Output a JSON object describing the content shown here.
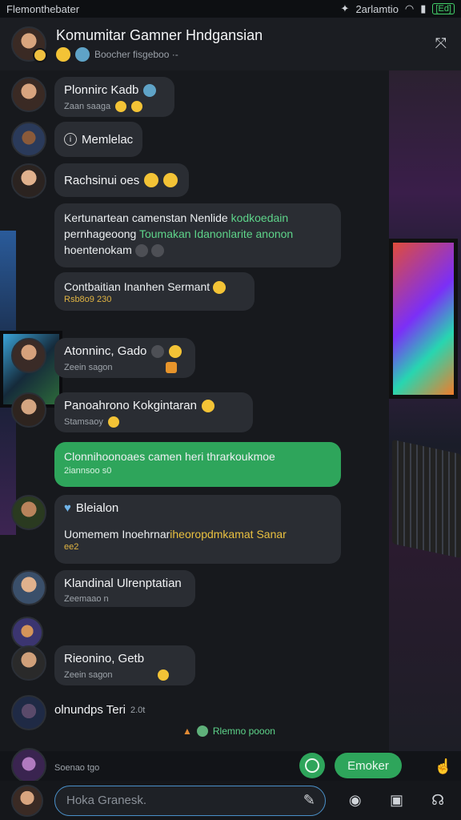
{
  "status_bar": {
    "left_text": "Flemonthebater",
    "time": "2arlamtio",
    "battery": "[Ed]"
  },
  "header": {
    "title": "Komumitar Gamner Hndgansian",
    "subtitle": "Boocher fisgeboo ·-"
  },
  "messages": [
    {
      "id": "m1",
      "name": "Plonnirc Kadb",
      "meta": "Zaan saaga"
    },
    {
      "id": "m2",
      "name": "Memlelac"
    },
    {
      "id": "m3",
      "name": "Rachsinui oes"
    },
    {
      "id": "m4",
      "lines": [
        {
          "parts": [
            {
              "t": "Kertunartean camenstan Nenlide ",
              "c": "w"
            },
            {
              "t": "kodkoedain",
              "c": "g"
            }
          ]
        },
        {
          "parts": [
            {
              "t": "pernhageoong ",
              "c": "w"
            },
            {
              "t": "Toumakan Idanonlarite anonon",
              "c": "g"
            }
          ]
        },
        {
          "parts": [
            {
              "t": "hoentenokam",
              "c": "w"
            }
          ]
        }
      ]
    },
    {
      "id": "m5",
      "text": "Contbaitian Inanhen Sermant",
      "meta": "Rsb8o9 230"
    },
    {
      "id": "m6",
      "name": "Atonninc, Gado",
      "meta": "Zeein sagon"
    },
    {
      "id": "m7",
      "name": "Panoahrono Kokgintaran",
      "meta": "Stamsaoy"
    },
    {
      "id": "m8",
      "text": "Clonnihoonoaes camen heri thrarkoukmoe",
      "meta": "2iannsoo s0"
    },
    {
      "id": "m9",
      "name": "Bleialon",
      "text_parts": [
        {
          "t": "Uomemem Inoehrnar",
          "c": "w"
        },
        {
          "t": "iheoropdmkamat Sanar",
          "c": "y"
        }
      ],
      "meta": "ee2"
    },
    {
      "id": "m10",
      "name": "Klandinal Ulrenptatian",
      "meta": "Zeemaao n"
    },
    {
      "id": "m11",
      "name": "Rieonino, Getb",
      "meta": "Zeein sagon"
    },
    {
      "id": "m12",
      "name": "olnundps Teri",
      "meta": "2.0t",
      "footer": "Rlemno pooon"
    },
    {
      "id": "m13",
      "name": "",
      "meta": "Soenao tgo"
    }
  ],
  "actions": {
    "quick_label": "Emoker"
  },
  "composer": {
    "placeholder": "Hoka Granesk."
  },
  "colors": {
    "accent_green": "#2ea55b",
    "bubble": "#2a2d33",
    "input_border": "#4a90c9"
  }
}
